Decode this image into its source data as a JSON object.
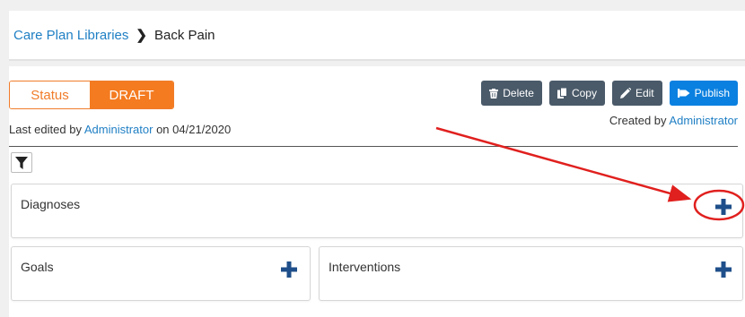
{
  "breadcrumb": {
    "parent": "Care Plan Libraries",
    "separator": "❯",
    "current": "Back Pain"
  },
  "status": {
    "label": "Status",
    "value": "DRAFT"
  },
  "meta": {
    "last_edited_prefix": "Last edited by",
    "last_edited_user": "Administrator",
    "last_edited_on": "on",
    "last_edited_date": "04/21/2020",
    "created_prefix": "Created by",
    "created_user": "Administrator"
  },
  "actions": {
    "delete": "Delete",
    "copy": "Copy",
    "edit": "Edit",
    "publish": "Publish"
  },
  "sections": {
    "diagnoses": "Diagnoses",
    "goals": "Goals",
    "interventions": "Interventions"
  },
  "colors": {
    "accent_orange": "#f47b20",
    "link_blue": "#1f7fc4",
    "button_dark": "#4a5a69",
    "button_blue": "#0a80e0",
    "plus_navy": "#1f4f8a",
    "annotation_red": "#e0201e"
  },
  "icons": {
    "filter": "filter-icon",
    "delete": "trash-icon",
    "copy": "copy-icon",
    "edit": "pencil-icon",
    "publish": "publish-icon",
    "add": "plus-icon"
  }
}
